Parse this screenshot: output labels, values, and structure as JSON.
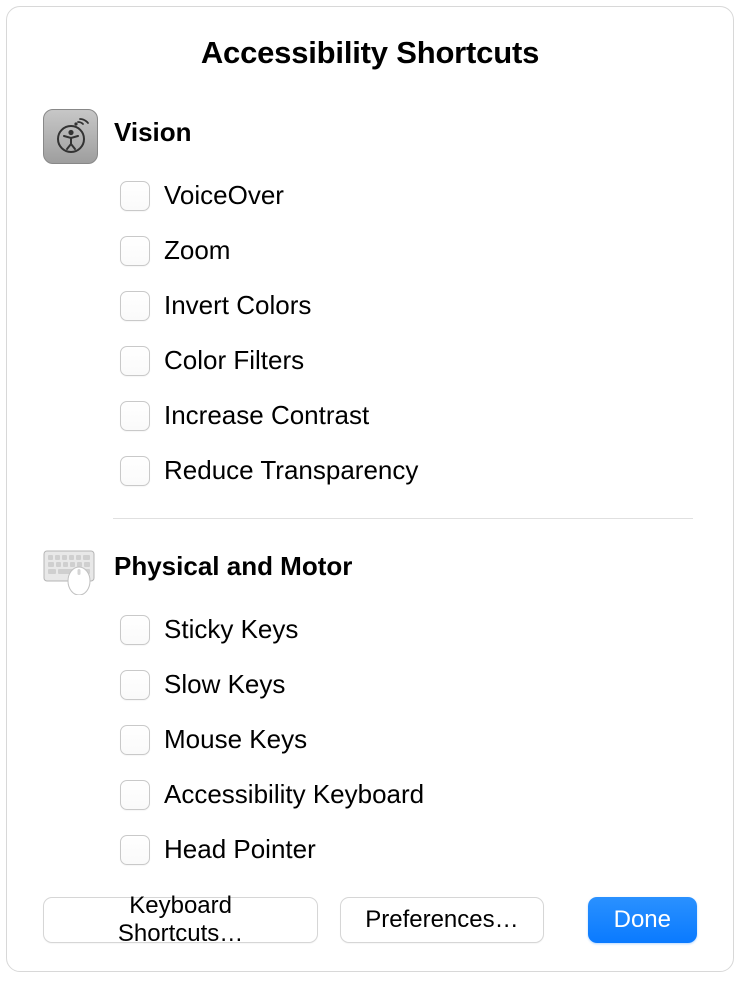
{
  "title": "Accessibility Shortcuts",
  "sections": [
    {
      "id": "vision",
      "title": "Vision",
      "icon": "accessibility-icon",
      "options": [
        {
          "id": "voiceover",
          "label": "VoiceOver",
          "checked": false
        },
        {
          "id": "zoom",
          "label": "Zoom",
          "checked": false
        },
        {
          "id": "invert-colors",
          "label": "Invert Colors",
          "checked": false
        },
        {
          "id": "color-filters",
          "label": "Color Filters",
          "checked": false
        },
        {
          "id": "increase-contrast",
          "label": "Increase Contrast",
          "checked": false
        },
        {
          "id": "reduce-transparency",
          "label": "Reduce Transparency",
          "checked": false
        }
      ]
    },
    {
      "id": "physical-motor",
      "title": "Physical and Motor",
      "icon": "keyboard-mouse-icon",
      "options": [
        {
          "id": "sticky-keys",
          "label": "Sticky Keys",
          "checked": false
        },
        {
          "id": "slow-keys",
          "label": "Slow Keys",
          "checked": false
        },
        {
          "id": "mouse-keys",
          "label": "Mouse Keys",
          "checked": false
        },
        {
          "id": "accessibility-keyboard",
          "label": "Accessibility Keyboard",
          "checked": false
        },
        {
          "id": "head-pointer",
          "label": "Head Pointer",
          "checked": false
        }
      ]
    }
  ],
  "footer": {
    "keyboard_shortcuts_label": "Keyboard Shortcuts…",
    "preferences_label": "Preferences…",
    "done_label": "Done"
  },
  "colors": {
    "primary_button": "#0a7aff",
    "border": "#d8d8d8",
    "divider": "#e0e0e0"
  }
}
